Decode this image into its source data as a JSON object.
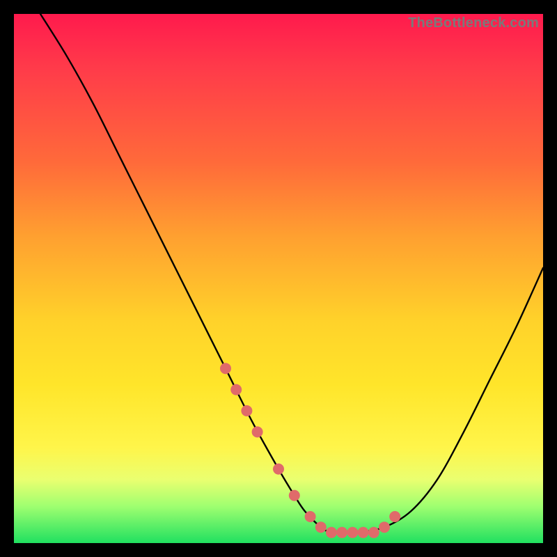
{
  "watermark": "TheBottleneck.com",
  "colors": {
    "dot": "#e06a6a",
    "curve": "#000000"
  },
  "chart_data": {
    "type": "line",
    "title": "",
    "xlabel": "",
    "ylabel": "",
    "xlim": [
      0,
      100
    ],
    "ylim": [
      0,
      100
    ],
    "grid": false,
    "series": [
      {
        "name": "bottleneck-curve",
        "x": [
          5,
          10,
          15,
          20,
          25,
          30,
          35,
          40,
          45,
          50,
          53,
          55,
          58,
          60,
          62,
          65,
          70,
          75,
          80,
          85,
          90,
          95,
          100
        ],
        "y": [
          100,
          92,
          83,
          73,
          63,
          53,
          43,
          33,
          23,
          14,
          9,
          6,
          3,
          2,
          2,
          2,
          3,
          6,
          12,
          21,
          31,
          41,
          52
        ]
      }
    ],
    "highlight_dots": {
      "name": "optimal-range-dots",
      "x": [
        40,
        42,
        44,
        46,
        50,
        53,
        56,
        58,
        60,
        62,
        64,
        66,
        68,
        70,
        72
      ],
      "y": [
        33,
        29,
        25,
        21,
        14,
        9,
        5,
        3,
        2,
        2,
        2,
        2,
        2,
        3,
        5
      ]
    }
  }
}
